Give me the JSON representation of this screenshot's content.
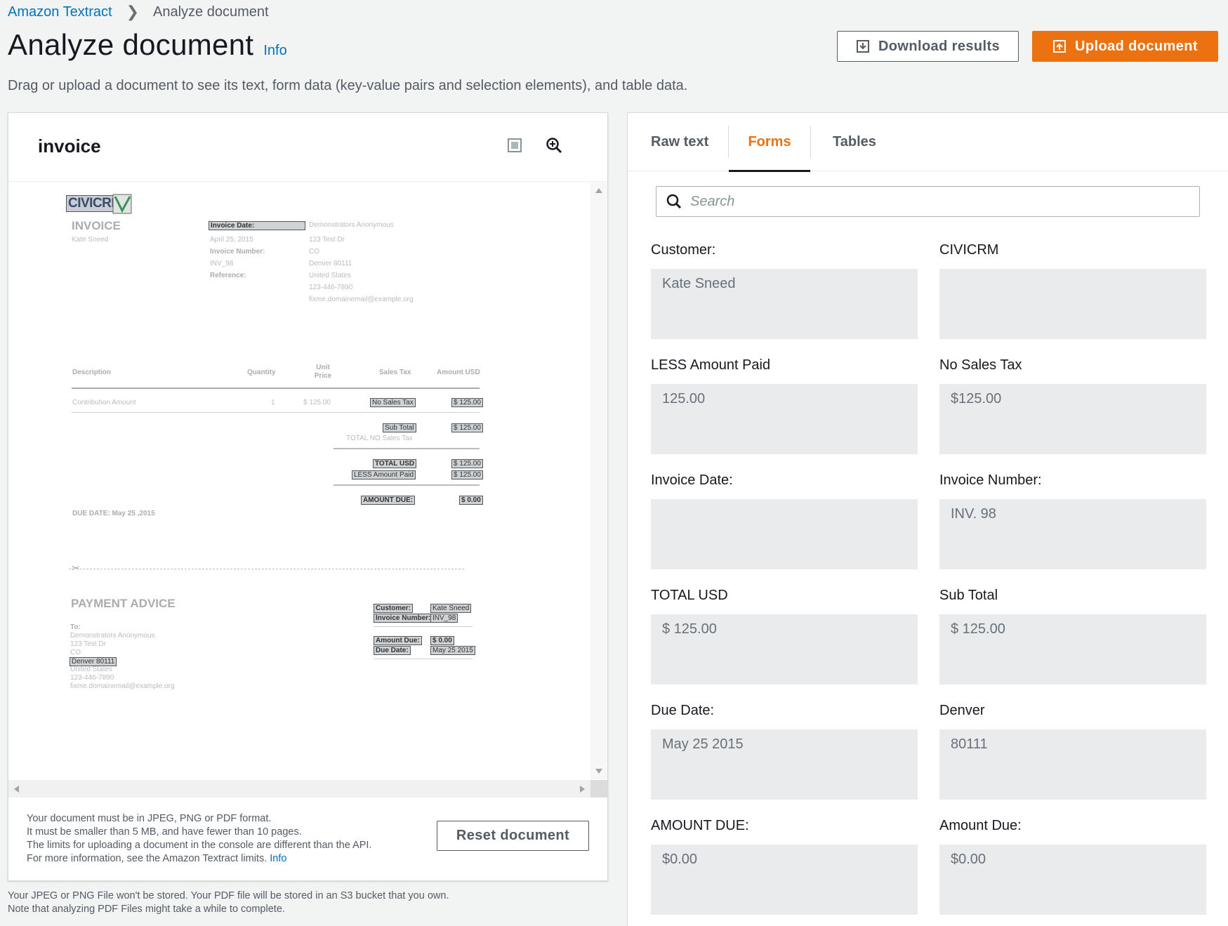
{
  "breadcrumb": {
    "root": "Amazon Textract",
    "current": "Analyze document"
  },
  "header": {
    "title": "Analyze document",
    "info": "Info",
    "description": "Drag or upload a document to see its text, form data (key-value pairs and selection elements), and table data."
  },
  "actions": {
    "download": "Download results",
    "upload": "Upload document"
  },
  "document": {
    "name": "invoice",
    "logo_text": "CIVICRM",
    "heading": "INVOICE",
    "customer": "Kate Sneed",
    "invoice_date_label": "Invoice Date:",
    "invoice_date_value": "April 25, 2015",
    "invoice_number_label": "Invoice Number:",
    "invoice_number_value": "INV_98",
    "reference_label": "Reference:",
    "address": [
      "Demonstrators Anonymous",
      "123 Test Dr",
      "CO",
      "Denver 80111",
      "United States",
      "123-446-7890",
      "fixme.domainemail@example.org"
    ],
    "table_headers": {
      "description": "Description",
      "quantity": "Quantity",
      "unit_price": "Unit Price",
      "sales_tax": "Sales Tax",
      "amount": "Amount USD"
    },
    "row": {
      "description": "Contribution Amount",
      "quantity": "1",
      "unit_price": "$ 125.00",
      "sales_tax": "No Sales Tax",
      "amount": "$ 125.00"
    },
    "sub_total_label": "Sub Total",
    "sub_total_value": "$ 125.00",
    "total_no_tax": "TOTAL NO Sales Tax",
    "total_usd_label": "TOTAL USD",
    "total_usd_value": "$ 125.00",
    "less_paid_label": "LESS Amount Paid",
    "less_paid_value": "$ 125.00",
    "amount_due_label": "AMOUNT DUE:",
    "amount_due_value": "$ 0.00",
    "due_date": "DUE DATE: May 25 ,2015",
    "payment_advice": "PAYMENT ADVICE",
    "to_label": "To:",
    "to_address": [
      "Demonstrators Anonymous",
      "123 Test Dr",
      "CO",
      "Denver 80111",
      "United States",
      "123-446-7890",
      "fixme.domainemail@example.org"
    ],
    "pa_customer_label": "Customer:",
    "pa_customer_value": "Kate Sneed",
    "pa_invoice_label": "Invoice Number:",
    "pa_invoice_value": "INV_98",
    "pa_amount_label": "Amount Due:",
    "pa_amount_value": "$ 0.00",
    "pa_due_label": "Due Date:",
    "pa_due_value": "May 25 2015"
  },
  "left_footer": {
    "line1": "Your document must be in JPEG, PNG or PDF format.",
    "line2": "It must be smaller than 5 MB, and have fewer than 10 pages.",
    "line3": "The limits for uploading a document in the console are different than the API.",
    "line4": "For more information, see the Amazon Textract limits.",
    "info": "Info",
    "reset": "Reset document"
  },
  "bottom_note": {
    "line1": "Your JPEG or PNG File won't be stored. Your PDF file will be stored in an S3 bucket that you own.",
    "line2": "Note that analyzing PDF Files might take a while to complete."
  },
  "tabs": [
    {
      "label": "Raw text"
    },
    {
      "label": "Forms"
    },
    {
      "label": "Tables"
    }
  ],
  "search": {
    "placeholder": "Search"
  },
  "forms": [
    {
      "key": "Customer:",
      "value": "Kate Sneed"
    },
    {
      "key": "CIVICRM",
      "value": ""
    },
    {
      "key": "LESS Amount Paid",
      "value": "125.00"
    },
    {
      "key": "No Sales Tax",
      "value": "$125.00"
    },
    {
      "key": "Invoice Date:",
      "value": ""
    },
    {
      "key": "Invoice Number:",
      "value": "INV. 98"
    },
    {
      "key": "TOTAL USD",
      "value": "$ 125.00"
    },
    {
      "key": "Sub Total",
      "value": "$ 125.00"
    },
    {
      "key": "Due Date:",
      "value": "May 25 2015"
    },
    {
      "key": "Denver",
      "value": "80111"
    },
    {
      "key": "AMOUNT DUE:",
      "value": "$0.00"
    },
    {
      "key": "Amount Due:",
      "value": "$0.00"
    }
  ],
  "colors": {
    "accent": "#ec7211",
    "link": "#0073bb"
  }
}
